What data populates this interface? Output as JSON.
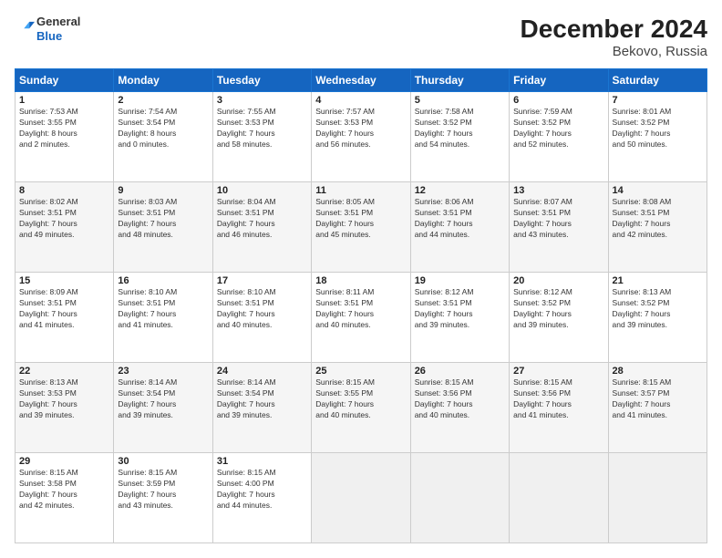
{
  "header": {
    "logo_line1": "General",
    "logo_line2": "Blue",
    "title": "December 2024",
    "subtitle": "Bekovo, Russia"
  },
  "days_of_week": [
    "Sunday",
    "Monday",
    "Tuesday",
    "Wednesday",
    "Thursday",
    "Friday",
    "Saturday"
  ],
  "weeks": [
    [
      {
        "day": 1,
        "sunrise": "7:53 AM",
        "sunset": "3:55 PM",
        "daylight": "8 hours and 2 minutes."
      },
      {
        "day": 2,
        "sunrise": "7:54 AM",
        "sunset": "3:54 PM",
        "daylight": "8 hours and 0 minutes."
      },
      {
        "day": 3,
        "sunrise": "7:55 AM",
        "sunset": "3:53 PM",
        "daylight": "7 hours and 58 minutes."
      },
      {
        "day": 4,
        "sunrise": "7:57 AM",
        "sunset": "3:53 PM",
        "daylight": "7 hours and 56 minutes."
      },
      {
        "day": 5,
        "sunrise": "7:58 AM",
        "sunset": "3:52 PM",
        "daylight": "7 hours and 54 minutes."
      },
      {
        "day": 6,
        "sunrise": "7:59 AM",
        "sunset": "3:52 PM",
        "daylight": "7 hours and 52 minutes."
      },
      {
        "day": 7,
        "sunrise": "8:01 AM",
        "sunset": "3:52 PM",
        "daylight": "7 hours and 50 minutes."
      }
    ],
    [
      {
        "day": 8,
        "sunrise": "8:02 AM",
        "sunset": "3:51 PM",
        "daylight": "7 hours and 49 minutes."
      },
      {
        "day": 9,
        "sunrise": "8:03 AM",
        "sunset": "3:51 PM",
        "daylight": "7 hours and 48 minutes."
      },
      {
        "day": 10,
        "sunrise": "8:04 AM",
        "sunset": "3:51 PM",
        "daylight": "7 hours and 46 minutes."
      },
      {
        "day": 11,
        "sunrise": "8:05 AM",
        "sunset": "3:51 PM",
        "daylight": "7 hours and 45 minutes."
      },
      {
        "day": 12,
        "sunrise": "8:06 AM",
        "sunset": "3:51 PM",
        "daylight": "7 hours and 44 minutes."
      },
      {
        "day": 13,
        "sunrise": "8:07 AM",
        "sunset": "3:51 PM",
        "daylight": "7 hours and 43 minutes."
      },
      {
        "day": 14,
        "sunrise": "8:08 AM",
        "sunset": "3:51 PM",
        "daylight": "7 hours and 42 minutes."
      }
    ],
    [
      {
        "day": 15,
        "sunrise": "8:09 AM",
        "sunset": "3:51 PM",
        "daylight": "7 hours and 41 minutes."
      },
      {
        "day": 16,
        "sunrise": "8:10 AM",
        "sunset": "3:51 PM",
        "daylight": "7 hours and 41 minutes."
      },
      {
        "day": 17,
        "sunrise": "8:10 AM",
        "sunset": "3:51 PM",
        "daylight": "7 hours and 40 minutes."
      },
      {
        "day": 18,
        "sunrise": "8:11 AM",
        "sunset": "3:51 PM",
        "daylight": "7 hours and 40 minutes."
      },
      {
        "day": 19,
        "sunrise": "8:12 AM",
        "sunset": "3:51 PM",
        "daylight": "7 hours and 39 minutes."
      },
      {
        "day": 20,
        "sunrise": "8:12 AM",
        "sunset": "3:52 PM",
        "daylight": "7 hours and 39 minutes."
      },
      {
        "day": 21,
        "sunrise": "8:13 AM",
        "sunset": "3:52 PM",
        "daylight": "7 hours and 39 minutes."
      }
    ],
    [
      {
        "day": 22,
        "sunrise": "8:13 AM",
        "sunset": "3:53 PM",
        "daylight": "7 hours and 39 minutes."
      },
      {
        "day": 23,
        "sunrise": "8:14 AM",
        "sunset": "3:54 PM",
        "daylight": "7 hours and 39 minutes."
      },
      {
        "day": 24,
        "sunrise": "8:14 AM",
        "sunset": "3:54 PM",
        "daylight": "7 hours and 39 minutes."
      },
      {
        "day": 25,
        "sunrise": "8:15 AM",
        "sunset": "3:55 PM",
        "daylight": "7 hours and 40 minutes."
      },
      {
        "day": 26,
        "sunrise": "8:15 AM",
        "sunset": "3:56 PM",
        "daylight": "7 hours and 40 minutes."
      },
      {
        "day": 27,
        "sunrise": "8:15 AM",
        "sunset": "3:56 PM",
        "daylight": "7 hours and 41 minutes."
      },
      {
        "day": 28,
        "sunrise": "8:15 AM",
        "sunset": "3:57 PM",
        "daylight": "7 hours and 41 minutes."
      }
    ],
    [
      {
        "day": 29,
        "sunrise": "8:15 AM",
        "sunset": "3:58 PM",
        "daylight": "7 hours and 42 minutes."
      },
      {
        "day": 30,
        "sunrise": "8:15 AM",
        "sunset": "3:59 PM",
        "daylight": "7 hours and 43 minutes."
      },
      {
        "day": 31,
        "sunrise": "8:15 AM",
        "sunset": "4:00 PM",
        "daylight": "7 hours and 44 minutes."
      },
      null,
      null,
      null,
      null
    ]
  ]
}
